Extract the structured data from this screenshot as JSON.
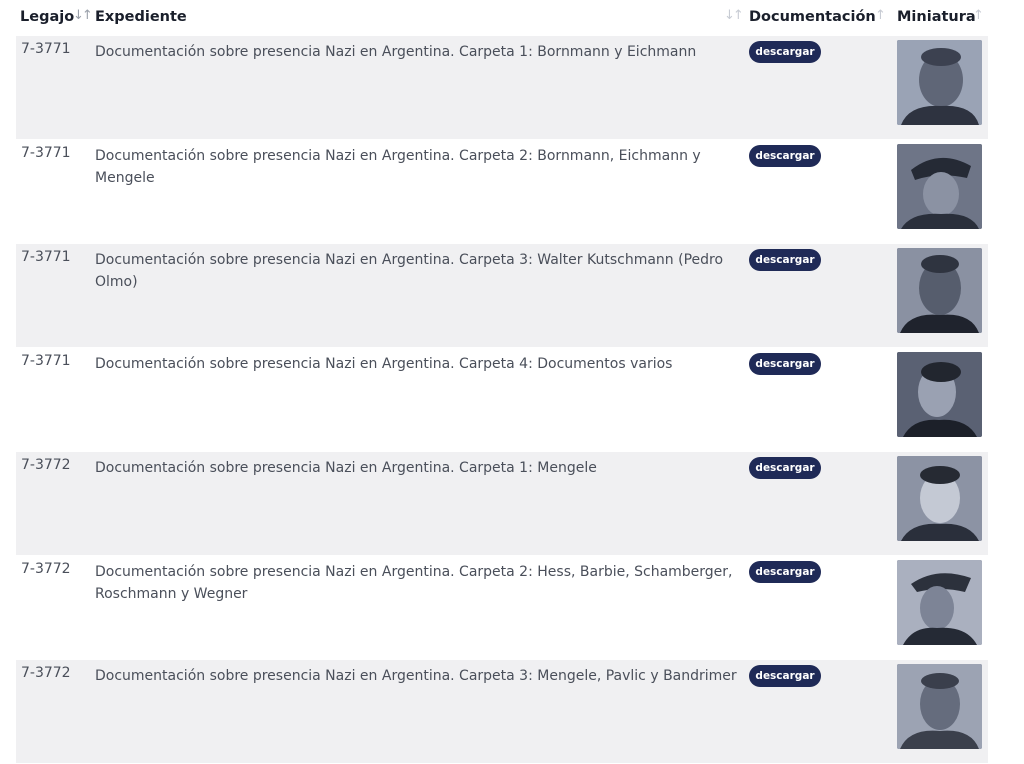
{
  "table": {
    "headers": {
      "legajo": "Legajo",
      "expediente": "Expediente",
      "documentacion": "Documentación",
      "miniatura": "Miniatura"
    },
    "rows": [
      {
        "legajo": "7-3771",
        "expediente": "Documentación sobre presencia Nazi en Argentina. Carpeta 1: Bornmann y Eichmann",
        "button": "descargar",
        "thumbnail": "portrait-photo"
      },
      {
        "legajo": "7-3771",
        "expediente": "Documentación sobre presencia Nazi en Argentina. Carpeta 2: Bornmann, Eichmann y Mengele",
        "button": "descargar",
        "thumbnail": "portrait-photo"
      },
      {
        "legajo": "7-3771",
        "expediente": "Documentación sobre presencia Nazi en Argentina. Carpeta 3: Walter Kutschmann (Pedro Olmo)",
        "button": "descargar",
        "thumbnail": "portrait-photo"
      },
      {
        "legajo": "7-3771",
        "expediente": "Documentación sobre presencia Nazi en Argentina. Carpeta 4: Documentos varios",
        "button": "descargar",
        "thumbnail": "portrait-photo"
      },
      {
        "legajo": "7-3772",
        "expediente": "Documentación sobre presencia Nazi en Argentina. Carpeta 1: Mengele",
        "button": "descargar",
        "thumbnail": "portrait-photo"
      },
      {
        "legajo": "7-3772",
        "expediente": "Documentación sobre presencia Nazi en Argentina. Carpeta 2: Hess, Barbie, Schamberger, Roschmann y Wegner",
        "button": "descargar",
        "thumbnail": "portrait-photo"
      },
      {
        "legajo": "7-3772",
        "expediente": "Documentación sobre presencia Nazi en Argentina. Carpeta 3: Mengele, Pavlic y Bandrimer",
        "button": "descargar",
        "thumbnail": "portrait-photo"
      }
    ]
  },
  "colors": {
    "button_bg": "#1f2a57",
    "row_odd": "#f0f0f2",
    "thumb_tint": "#7c8396"
  },
  "icons": {
    "sort": "sort-arrows-icon"
  }
}
